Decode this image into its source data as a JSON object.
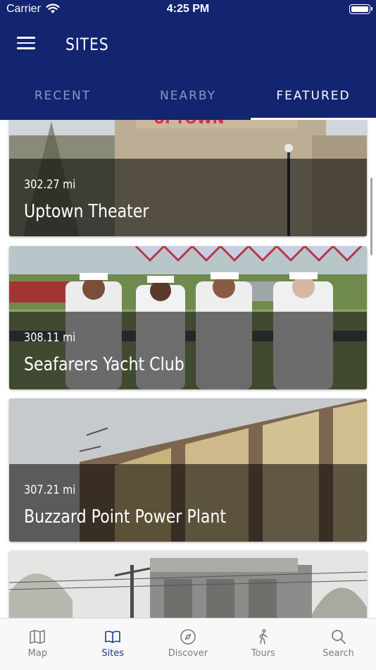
{
  "status_bar": {
    "carrier": "Carrier",
    "time": "4:25 PM"
  },
  "header": {
    "title": "SITES",
    "menu_icon": "hamburger-icon"
  },
  "tabs": [
    {
      "label": "RECENT",
      "active": false
    },
    {
      "label": "NEARBY",
      "active": false
    },
    {
      "label": "FEATURED",
      "active": true
    }
  ],
  "sites": [
    {
      "distance": "302.27 mi",
      "name": "Uptown Theater",
      "sign": "UPTOWN"
    },
    {
      "distance": "308.11 mi",
      "name": "Seafarers Yacht Club"
    },
    {
      "distance": "307.21 mi",
      "name": "Buzzard Point Power Plant"
    },
    {
      "distance": "",
      "name": ""
    }
  ],
  "tabbar": [
    {
      "label": "Map",
      "icon": "map-icon",
      "active": false
    },
    {
      "label": "Sites",
      "icon": "book-icon",
      "active": true
    },
    {
      "label": "Discover",
      "icon": "compass-icon",
      "active": false
    },
    {
      "label": "Tours",
      "icon": "walking-person-icon",
      "active": false
    },
    {
      "label": "Search",
      "icon": "search-icon",
      "active": false
    }
  ],
  "colors": {
    "header": "#132470",
    "active_tab_icon": "#1d3a8c",
    "inactive_tab_icon": "#7c7c7c"
  }
}
